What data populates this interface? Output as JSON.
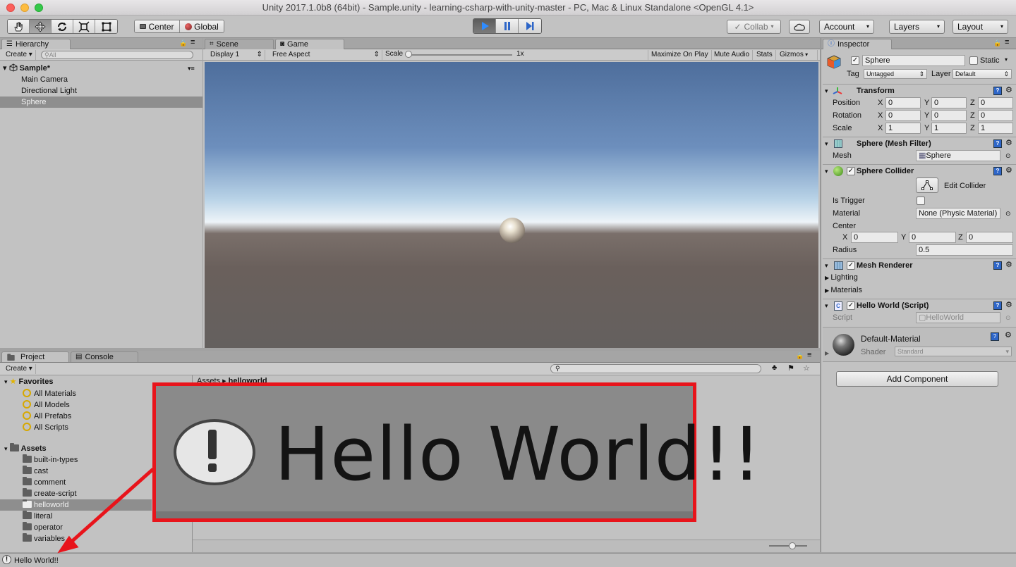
{
  "window": {
    "title": "Unity 2017.1.0b8 (64bit) - Sample.unity - learning-csharp-with-unity-master - PC, Mac & Linux Standalone <OpenGL 4.1>"
  },
  "toolbar": {
    "pivot_label": "Center",
    "space_label": "Global",
    "collab_label": "Collab",
    "account_label": "Account",
    "layers_label": "Layers",
    "layout_label": "Layout"
  },
  "hierarchy": {
    "tab_label": "Hierarchy",
    "create_label": "Create",
    "search_placeholder": "All",
    "scene_name": "Sample*",
    "items": [
      "Main Camera",
      "Directional Light",
      "Sphere"
    ]
  },
  "game_view": {
    "tabs": [
      "Scene",
      "Game"
    ],
    "display": "Display 1",
    "aspect": "Free Aspect",
    "scale_label": "Scale",
    "scale_value": "1x",
    "options": [
      "Maximize On Play",
      "Mute Audio",
      "Stats",
      "Gizmos"
    ]
  },
  "inspector": {
    "tab_label": "Inspector",
    "object_name": "Sphere",
    "static_label": "Static",
    "tag_label": "Tag",
    "tag_value": "Untagged",
    "layer_label": "Layer",
    "layer_value": "Default",
    "transform": {
      "title": "Transform",
      "rows": [
        {
          "label": "Position",
          "x": "0",
          "y": "0",
          "z": "0"
        },
        {
          "label": "Rotation",
          "x": "0",
          "y": "0",
          "z": "0"
        },
        {
          "label": "Scale",
          "x": "1",
          "y": "1",
          "z": "1"
        }
      ]
    },
    "mesh_filter": {
      "title": "Sphere (Mesh Filter)",
      "mesh_label": "Mesh",
      "mesh_value": "Sphere"
    },
    "sphere_collider": {
      "title": "Sphere Collider",
      "edit_label": "Edit Collider",
      "is_trigger_label": "Is Trigger",
      "material_label": "Material",
      "material_value": "None (Physic Material)",
      "center_label": "Center",
      "center": {
        "x": "0",
        "y": "0",
        "z": "0"
      },
      "radius_label": "Radius",
      "radius_value": "0.5"
    },
    "mesh_renderer": {
      "title": "Mesh Renderer",
      "lighting_label": "Lighting",
      "materials_label": "Materials"
    },
    "script": {
      "title": "Hello World (Script)",
      "script_label": "Script",
      "script_value": "HelloWorld"
    },
    "material": {
      "name": "Default-Material",
      "shader_label": "Shader",
      "shader_value": "Standard"
    },
    "add_component_label": "Add Component"
  },
  "project": {
    "tabs": [
      "Project",
      "Console"
    ],
    "create_label": "Create",
    "favorites_label": "Favorites",
    "favorites": [
      "All Materials",
      "All Models",
      "All Prefabs",
      "All Scripts"
    ],
    "assets_label": "Assets",
    "folders": [
      "built-in-types",
      "cast",
      "comment",
      "create-script",
      "helloworld",
      "literal",
      "operator",
      "variables"
    ],
    "breadcrumb_root": "Assets",
    "breadcrumb_folder": "helloworld"
  },
  "status": {
    "message": "Hello World!!"
  },
  "callout": {
    "message": "Hello World!!"
  },
  "colors": {
    "accent_blue": "#2e66c8",
    "selection": "#8e8e8e",
    "callout_red": "#e8141b"
  }
}
